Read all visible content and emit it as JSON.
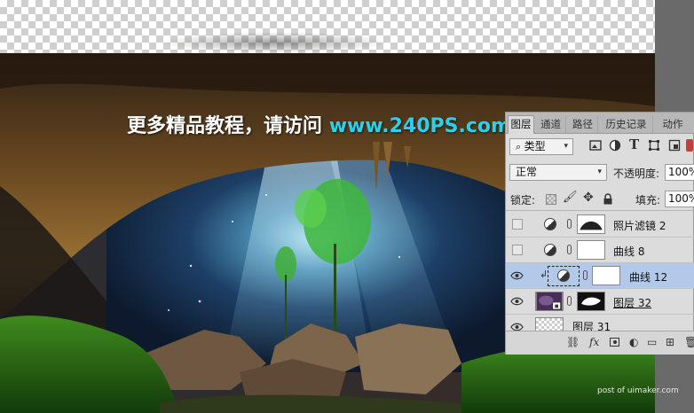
{
  "watermark": {
    "chinese_text": "更多精品教程，请访问",
    "url_text": "www.240PS.com"
  },
  "credit": "post of uimaker.com",
  "layers_panel": {
    "tabs": [
      {
        "label": "图层",
        "active": true
      },
      {
        "label": "通道",
        "active": false
      },
      {
        "label": "路径",
        "active": false
      },
      {
        "label": "历史记录",
        "active": false
      },
      {
        "label": "动作",
        "active": false
      }
    ],
    "filter_kind": "类型",
    "filter_icons": [
      "image-filter-icon",
      "adjustment-filter-icon",
      "text-filter-icon",
      "shape-filter-icon",
      "smart-object-filter-icon"
    ],
    "blend_mode": "正常",
    "opacity_label": "不透明度:",
    "opacity_value": "100%",
    "lock_label": "锁定:",
    "fill_label": "填充:",
    "fill_value": "100%",
    "layers": [
      {
        "name": "照片滤镜 2",
        "visible": false,
        "type": "adjustment",
        "selected": false
      },
      {
        "name": "曲线 8",
        "visible": false,
        "type": "adjustment",
        "selected": false
      },
      {
        "name": "曲线 12",
        "visible": true,
        "type": "adjustment-clipped",
        "selected": true
      },
      {
        "name": "图层 32",
        "visible": true,
        "type": "smart-object-with-mask",
        "selected": false
      },
      {
        "name": "图层 31",
        "visible": true,
        "type": "pixel",
        "selected": false
      }
    ],
    "bottom_icons": [
      "link-layers-icon",
      "fx-icon",
      "add-mask-icon",
      "new-adjustment-icon",
      "new-group-icon",
      "new-layer-icon"
    ],
    "bottom_fx_label": "fx"
  },
  "colors": {
    "url_cyan": "#2ad1ea",
    "selected_row": "#b3c9ea"
  }
}
